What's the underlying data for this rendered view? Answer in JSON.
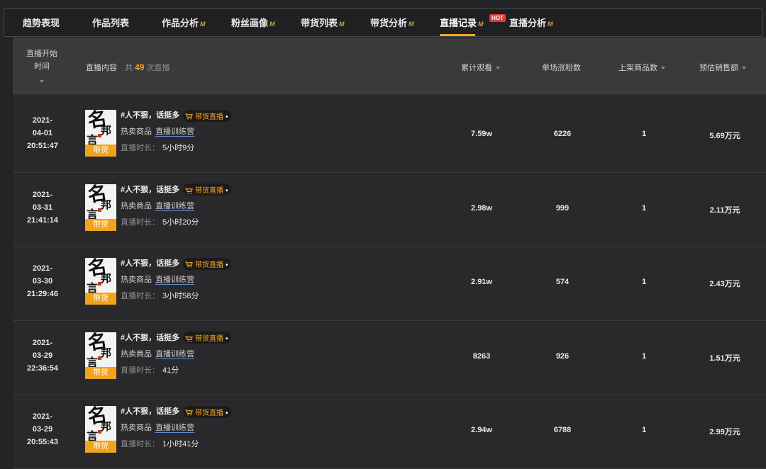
{
  "tabs": [
    {
      "label": "趋势表现",
      "pro": false,
      "active": false
    },
    {
      "label": "作品列表",
      "pro": false,
      "active": false
    },
    {
      "label": "作品分析",
      "pro": true,
      "active": false
    },
    {
      "label": "粉丝画像",
      "pro": true,
      "active": false
    },
    {
      "label": "带货列表",
      "pro": true,
      "active": false
    },
    {
      "label": "带货分析",
      "pro": true,
      "active": false
    },
    {
      "label": "直播记录",
      "pro": true,
      "active": true
    },
    {
      "label": "直播分析",
      "pro": true,
      "active": false
    }
  ],
  "pro_mark": "M",
  "hot_badge": "HOT",
  "table": {
    "col_time": "直播开始时间",
    "col_content": "直播内容",
    "count_prefix": "共",
    "count": "49",
    "count_suffix": "次直播",
    "col_views": "累计观看",
    "col_fans": "单场涨粉数",
    "col_products": "上架商品数",
    "col_sales": "预估销售额"
  },
  "thumb": {
    "chars": [
      "名",
      "邦",
      "言"
    ],
    "badge": "带货"
  },
  "rows": [
    {
      "date": "2021-",
      "md": "04-01",
      "time": "20:51:47",
      "title": "#人不狠，话挺多",
      "tag": "带货直播",
      "hot_label": "热卖商品",
      "hot_link": "直播训练营",
      "dur_label": "直播时长：",
      "duration": "5小时9分",
      "views": "7.59w",
      "fans": "6226",
      "products": "1",
      "sales": "5.69万元"
    },
    {
      "date": "2021-",
      "md": "03-31",
      "time": "21:41:14",
      "title": "#人不狠，话挺多",
      "tag": "带货直播",
      "hot_label": "热卖商品",
      "hot_link": "直播训练营",
      "dur_label": "直播时长：",
      "duration": "5小时20分",
      "views": "2.98w",
      "fans": "999",
      "products": "1",
      "sales": "2.11万元"
    },
    {
      "date": "2021-",
      "md": "03-30",
      "time": "21:29:46",
      "title": "#人不狠，话挺多",
      "tag": "带货直播",
      "hot_label": "热卖商品",
      "hot_link": "直播训练营",
      "dur_label": "直播时长：",
      "duration": "3小时58分",
      "views": "2.91w",
      "fans": "574",
      "products": "1",
      "sales": "2.43万元"
    },
    {
      "date": "2021-",
      "md": "03-29",
      "time": "22:36:54",
      "title": "#人不狠，话挺多",
      "tag": "带货直播",
      "hot_label": "热卖商品",
      "hot_link": "直播训练营",
      "dur_label": "直播时长：",
      "duration": "41分",
      "views": "8263",
      "fans": "926",
      "products": "1",
      "sales": "1.51万元"
    },
    {
      "date": "2021-",
      "md": "03-29",
      "time": "20:55:43",
      "title": "#人不狠，话挺多",
      "tag": "带货直播",
      "hot_label": "热卖商品",
      "hot_link": "直播训练营",
      "dur_label": "直播时长：",
      "duration": "1小时41分",
      "views": "2.94w",
      "fans": "6788",
      "products": "1",
      "sales": "2.99万元"
    }
  ],
  "colors": {
    "accent": "#f5a623",
    "hot": "#e23a3a",
    "link_underline": "#5a8dd6"
  }
}
